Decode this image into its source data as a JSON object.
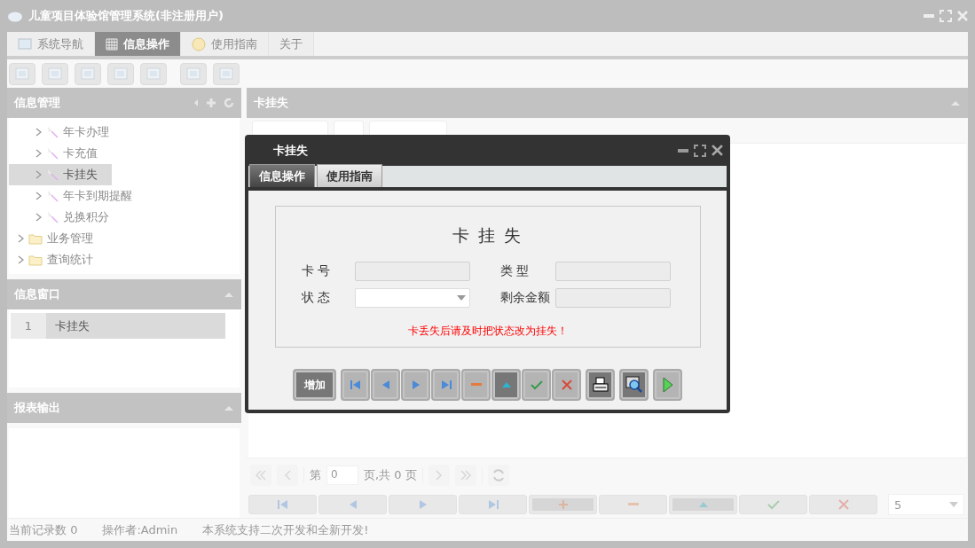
{
  "window": {
    "title": "儿童项目体验馆管理系统(非注册用户)"
  },
  "menu_tabs": [
    {
      "label": "系统导航",
      "selected": false
    },
    {
      "label": "信息操作",
      "selected": true
    },
    {
      "label": "使用指南",
      "selected": false
    },
    {
      "label": "关于",
      "selected": false
    }
  ],
  "nav_panel": {
    "title": "信息管理",
    "tree": [
      {
        "label": "年卡办理",
        "kind": "task",
        "selected": false
      },
      {
        "label": "卡充值",
        "kind": "task",
        "selected": false
      },
      {
        "label": "卡挂失",
        "kind": "task",
        "selected": true
      },
      {
        "label": "年卡到期提醒",
        "kind": "task",
        "selected": false
      },
      {
        "label": "兑换积分",
        "kind": "task",
        "selected": false
      },
      {
        "label": "业务管理",
        "kind": "folder",
        "selected": false
      },
      {
        "label": "查询统计",
        "kind": "folder",
        "selected": false
      }
    ]
  },
  "window_panel": {
    "title": "信息窗口",
    "items": [
      {
        "number": "1",
        "label": "卡挂失",
        "selected": true
      }
    ]
  },
  "report_panel": {
    "title": "报表输出"
  },
  "main_panel": {
    "title": "卡挂失",
    "pager": {
      "page_prefix": "第",
      "page": "0",
      "page_suffix": "页,共 0 页"
    },
    "buttons": [
      {
        "kind": "first",
        "highlighted": false
      },
      {
        "kind": "prev",
        "highlighted": false
      },
      {
        "kind": "next",
        "highlighted": false
      },
      {
        "kind": "last",
        "highlighted": false
      },
      {
        "kind": "add",
        "highlighted": true
      },
      {
        "kind": "minus",
        "highlighted": false
      },
      {
        "kind": "up",
        "highlighted": true
      },
      {
        "kind": "confirm",
        "highlighted": false
      },
      {
        "kind": "cross",
        "highlighted": false
      }
    ],
    "page_size": "5"
  },
  "dialog": {
    "title": "卡挂失",
    "tabs": [
      {
        "label": "信息操作",
        "selected": true
      },
      {
        "label": "使用指南",
        "selected": false
      }
    ],
    "form_title": "卡 挂 失",
    "fields": [
      {
        "label": "卡 号",
        "kind": "text"
      },
      {
        "label": "类 型",
        "kind": "text"
      },
      {
        "label": "状 态",
        "kind": "select"
      },
      {
        "label": "剩余金额",
        "kind": "text"
      }
    ],
    "note": "卡丢失后请及时把状态改为挂失！",
    "buttons": [
      {
        "kind": "text",
        "label": "增加",
        "highlighted": true
      },
      {
        "kind": "first",
        "highlighted": false
      },
      {
        "kind": "prev",
        "highlighted": false
      },
      {
        "kind": "next",
        "highlighted": false
      },
      {
        "kind": "last",
        "highlighted": false
      },
      {
        "kind": "minus",
        "highlighted": false
      },
      {
        "kind": "up",
        "highlighted": true
      },
      {
        "kind": "confirm",
        "highlighted": false
      },
      {
        "kind": "cross",
        "highlighted": false
      },
      {
        "kind": "print",
        "highlighted": true
      },
      {
        "kind": "preview",
        "highlighted": true
      },
      {
        "kind": "play",
        "highlighted": false
      }
    ]
  },
  "status_bar": [
    "当前记录数 0",
    "操作者:Admin",
    "本系统支持二次开发和全新开发!"
  ]
}
